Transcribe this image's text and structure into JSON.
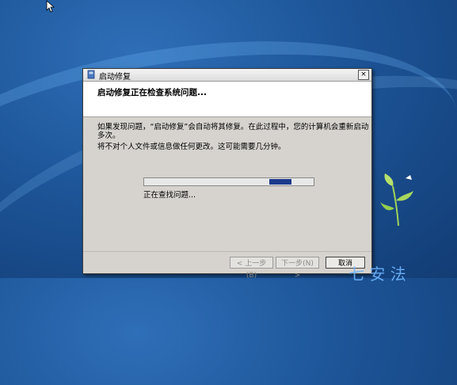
{
  "dialog": {
    "title": "启动修复",
    "close_glyph": "×",
    "header": "启动修复正在检查系统问题...",
    "body_line1": "如果发现问题，“启动修复”会自动将其修复。在此过程中，您的计算机会重新启动",
    "body_line1b": "多次。",
    "body_line2": "将不对个人文件或信息做任何更改。这可能需要几分钟。",
    "progress_fraction": 0.13,
    "status": "正在查找问题...",
    "buttons": {
      "back": "< 上一步(B)",
      "next": "下一步(N) >",
      "cancel": "取消"
    }
  },
  "watermark": "七 安 法",
  "icons": [
    "cursor-icon",
    "window-icon",
    "close-icon",
    "plant-icon"
  ]
}
